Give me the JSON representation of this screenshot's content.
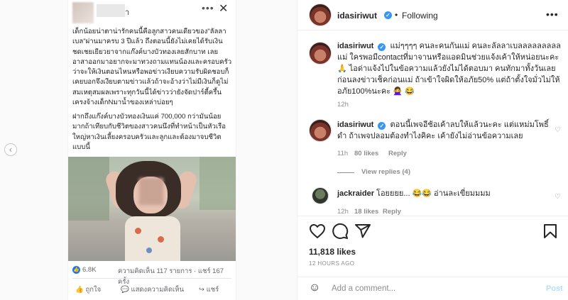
{
  "media": {
    "edge_button_icon": "‹",
    "screenshot": {
      "name_suffix": "า",
      "paragraph1": "เด็กน้อยน่าตาน่ารักคนนี้คือลูกสาวคนเดียวของ\"ลัลลาเบล\"ผ่านมาครบ 3 ปีแล้ว ถึงตอนนี้ยังไม่เคยได้รับเงินชดเชยเยียวยาจากแก๊งค์บางบัวทองเลยสักบาท เลยอาสาออกมาอยากจะมาทวงถามแทนน้องและครอบครัวว่าจะให้เงินตอนไหนหรือพอข่าวเงียบความรับผิดชอบก็เคยบอกจึงเงียบตามข่าวแล้วถ้าจะอ้างว่าไม่มีเงินก็ดูไม่สมเหตุสมผลเพราะทุกวันนี้ได้ข่าวว่ายังจัดปาร์ตี้ครึ้นเครงจ้างเด็กNมาน้ำของเหล่าบ่อยๆ",
      "paragraph2": "ฝากถึงแก๊งค์บางบัวทองเงินแค่ 700,000 กว่ามันน้อยมากถ้าเทียบกับชีวิตของสาวคนนึงที่ทำหน้าเป็นหัวเรือใหญ่หาเงินเลี้ยงครอบครัวและลูกและต้องมาจบชีวิตแบบนี้",
      "reaction_count": "6.8K",
      "comments_shares": "ความคิดเห็น 117 รายการ · แชร์ 167 ครั้ง",
      "like_label": "ถูกใจ",
      "comment_label": "แสดงความคิดเห็น",
      "share_label": "แชร์"
    }
  },
  "header": {
    "username": "idasiriwut",
    "separator": "•",
    "follow_status": "Following",
    "more": "•••"
  },
  "comments": [
    {
      "username": "idasiriwut",
      "text": "แม่ๆๆๆๆ คนละคนกันแม่ คนละลัลลาเบลลลลลลลลลแม่ ใครพอมีcontactที่มาจานหรือแอดมินช่วยแจ้งเค้าให้หน่อยนะคะ 🙏 ไอด่าแจ้งไปในข้อความแล้วยังไม่ได้ตอบมา คนทักมาทั้งวันเลย ก่อนลงข่าวเช็คก่อนแม่ ถ้าเข้าใจผิดให้อภัย50% แต่ถ้าตั้งใจมั่วไม่ให้อภัย100%นะคะ 🙅‍♀️ 😂",
      "time": "12h"
    },
    {
      "username": "idasiriwut",
      "text": "ตอนนี้เพจอีช้อเค้าลบให้แล้วนะคะ แต่แหม่มโพธิ์ดำ ถ้าเพจปลอมต้องทำไงคิคะ เค้ายังไม่อ่านข้อความเลย",
      "time": "11h",
      "likes": "80 likes",
      "reply": "Reply"
    },
    {
      "username": "jackraider",
      "text": "โอยยยย... 😂😂 อ่านละเขี่ยมมมม",
      "time": "12h",
      "likes": "18 likes",
      "reply": "Reply"
    }
  ],
  "view_replies": "View replies (4)",
  "stats": {
    "likes": "11,818 likes",
    "time_ago": "12 HOURS AGO"
  },
  "add_comment": {
    "placeholder": "Add a comment...",
    "post_label": "Post"
  },
  "icons": [
    "heart-icon",
    "comment-icon",
    "share-icon",
    "bookmark-icon",
    "emoji-icon",
    "verified-icon",
    "more-icon"
  ],
  "colors": {
    "verified": "#3897f0",
    "post_disabled": "#b2dffc",
    "meta": "#8e8e8e"
  }
}
